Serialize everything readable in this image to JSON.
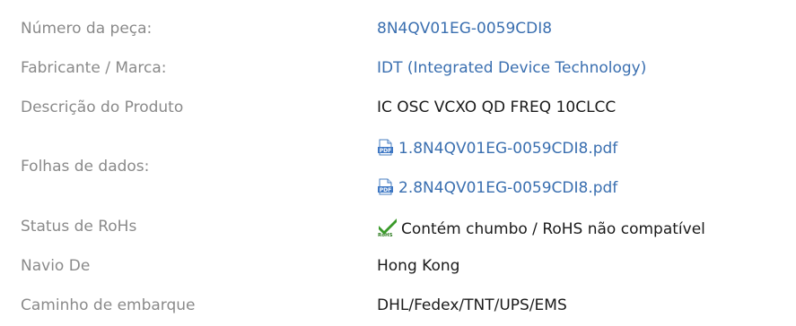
{
  "rows": [
    {
      "label": "Número da peça:",
      "value": "8N4QV01EG-0059CDI8"
    },
    {
      "label": "Fabricante / Marca:",
      "value": "IDT (Integrated Device Technology)"
    },
    {
      "label": "Descrição do Produto",
      "value": "IC OSC VCXO QD FREQ 10CLCC"
    },
    {
      "label": "Folhas de dados:",
      "files": [
        "1.8N4QV01EG-0059CDI8.pdf",
        "2.8N4QV01EG-0059CDI8.pdf"
      ]
    },
    {
      "label": "Status de RoHs",
      "value": "Contém chumbo / RoHS não compatível"
    },
    {
      "label": "Navio De",
      "value": "Hong Kong"
    },
    {
      "label": "Caminho de embarque",
      "value": "DHL/Fedex/TNT/UPS/EMS"
    }
  ],
  "icons": {
    "datasheet": "pdf-icon",
    "rohs": "rohs-check-icon"
  },
  "colors": {
    "label": "#8a8a8a",
    "link": "#3a6fb0",
    "value": "#1a1a1a"
  }
}
